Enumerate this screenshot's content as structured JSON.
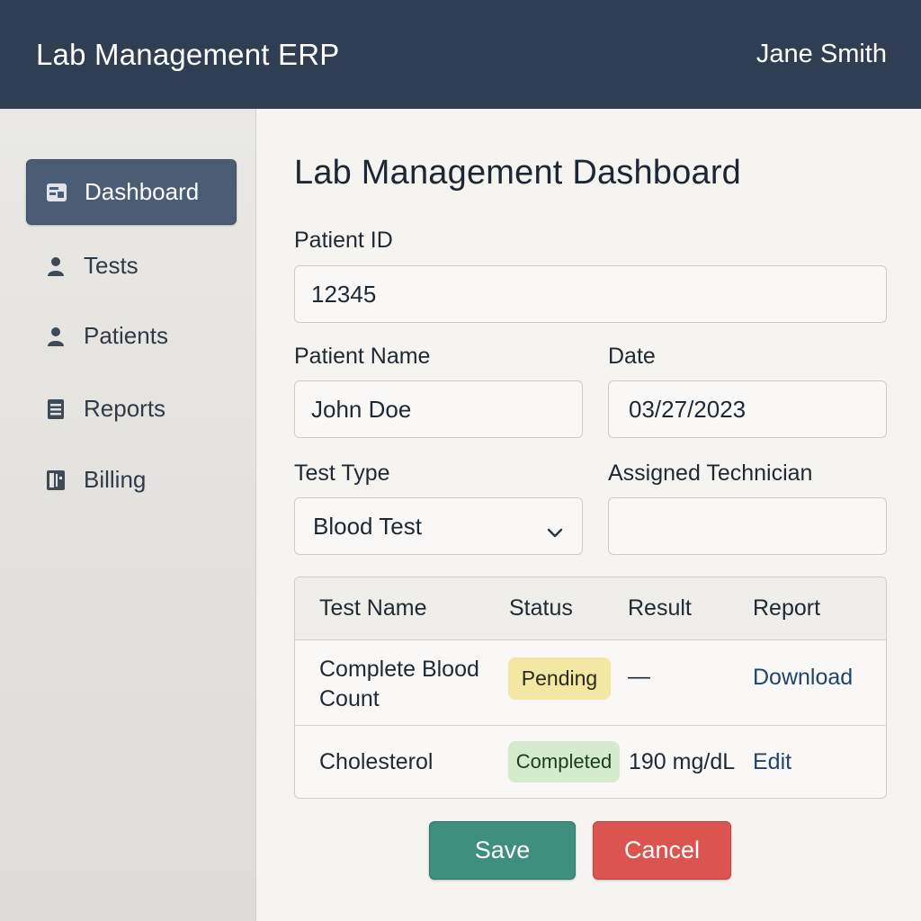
{
  "header": {
    "app_title": "Lab Management ERP",
    "user_name": "Jane Smith"
  },
  "sidebar": {
    "items": [
      {
        "label": "Dashboard",
        "icon": "dashboard-icon",
        "active": true
      },
      {
        "label": "Tests",
        "icon": "person-icon",
        "active": false
      },
      {
        "label": "Patients",
        "icon": "person-icon",
        "active": false
      },
      {
        "label": "Reports",
        "icon": "document-icon",
        "active": false
      },
      {
        "label": "Billing",
        "icon": "invoice-icon",
        "active": false
      }
    ]
  },
  "main": {
    "title": "Lab Management Dashboard",
    "form": {
      "patient_id": {
        "label": "Patient ID",
        "value": "12345"
      },
      "patient_name": {
        "label": "Patient Name",
        "value": "John Doe"
      },
      "date": {
        "label": "Date",
        "value": "03/27/2023"
      },
      "test_type": {
        "label": "Test Type",
        "value": "Blood Test"
      },
      "assigned_technician": {
        "label": "Assigned Technician",
        "value": ""
      }
    },
    "table": {
      "headers": [
        "Test Name",
        "Status",
        "Result",
        "Report"
      ],
      "rows": [
        {
          "test_name": "Complete Blood Count",
          "status": "Pending",
          "result": "—",
          "report": "Download"
        },
        {
          "test_name": "Cholesterol",
          "status": "Completed",
          "result": "190 mg/dL",
          "report": "Edit"
        }
      ]
    },
    "actions": {
      "save_label": "Save",
      "cancel_label": "Cancel"
    }
  },
  "colors": {
    "header_bg": "#2f3e52",
    "active_nav": "#4b5d75",
    "save": "#3e8f7e",
    "cancel": "#dc5450",
    "pending": "#f4e6a3",
    "completed": "#d5ebcb",
    "link": "#22446b"
  }
}
